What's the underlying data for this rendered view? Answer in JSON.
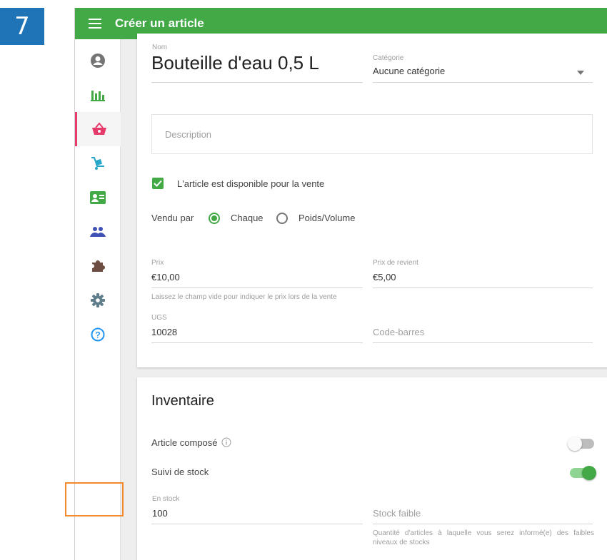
{
  "step_number": "7",
  "header": {
    "title": "Créer un article"
  },
  "sidebar": {
    "items": [
      {
        "name": "account-icon",
        "color": "#757575"
      },
      {
        "name": "reports-icon",
        "color": "#43a947"
      },
      {
        "name": "items-icon",
        "color": "#e63a6b",
        "active": true
      },
      {
        "name": "inventory-icon",
        "color": "#26a6c8"
      },
      {
        "name": "employees-icon",
        "color": "#43a947"
      },
      {
        "name": "customers-icon",
        "color": "#3f51b5"
      },
      {
        "name": "integrations-icon",
        "color": "#6d4c41"
      },
      {
        "name": "settings-icon",
        "color": "#607d8b"
      },
      {
        "name": "help-icon",
        "color": "#2196f3"
      }
    ]
  },
  "item": {
    "name_label": "Nom",
    "name_value": "Bouteille d'eau 0,5 L",
    "category_label": "Catégorie",
    "category_value": "Aucune catégorie",
    "description_placeholder": "Description",
    "available_label": "L'article est disponible pour la vente",
    "available_checked": true,
    "sold_by_label": "Vendu par",
    "sold_by_each": "Chaque",
    "sold_by_weight": "Poids/Volume",
    "sold_by_selected": "Chaque",
    "price_label": "Prix",
    "price_value": "€10,00",
    "price_hint": "Laissez le champ vide pour indiquer le prix lors de la vente",
    "cost_label": "Prix de revient",
    "cost_value": "€5,00",
    "sku_label": "UGS",
    "sku_value": "10028",
    "barcode_placeholder": "Code-barres"
  },
  "inventory": {
    "title": "Inventaire",
    "composite_label": "Article composé",
    "composite_on": false,
    "track_stock_label": "Suivi de stock",
    "track_stock_on": true,
    "in_stock_label": "En stock",
    "in_stock_value": "100",
    "low_stock_placeholder": "Stock faible",
    "low_stock_hint": "Quantité d'articles à laquelle vous serez informé(e) des faibles niveaux de stocks"
  },
  "colors": {
    "brand_green": "#43a947",
    "active_pink": "#e63a6b",
    "highlight_orange": "#f08a2c",
    "step_blue": "#1f73b7"
  }
}
